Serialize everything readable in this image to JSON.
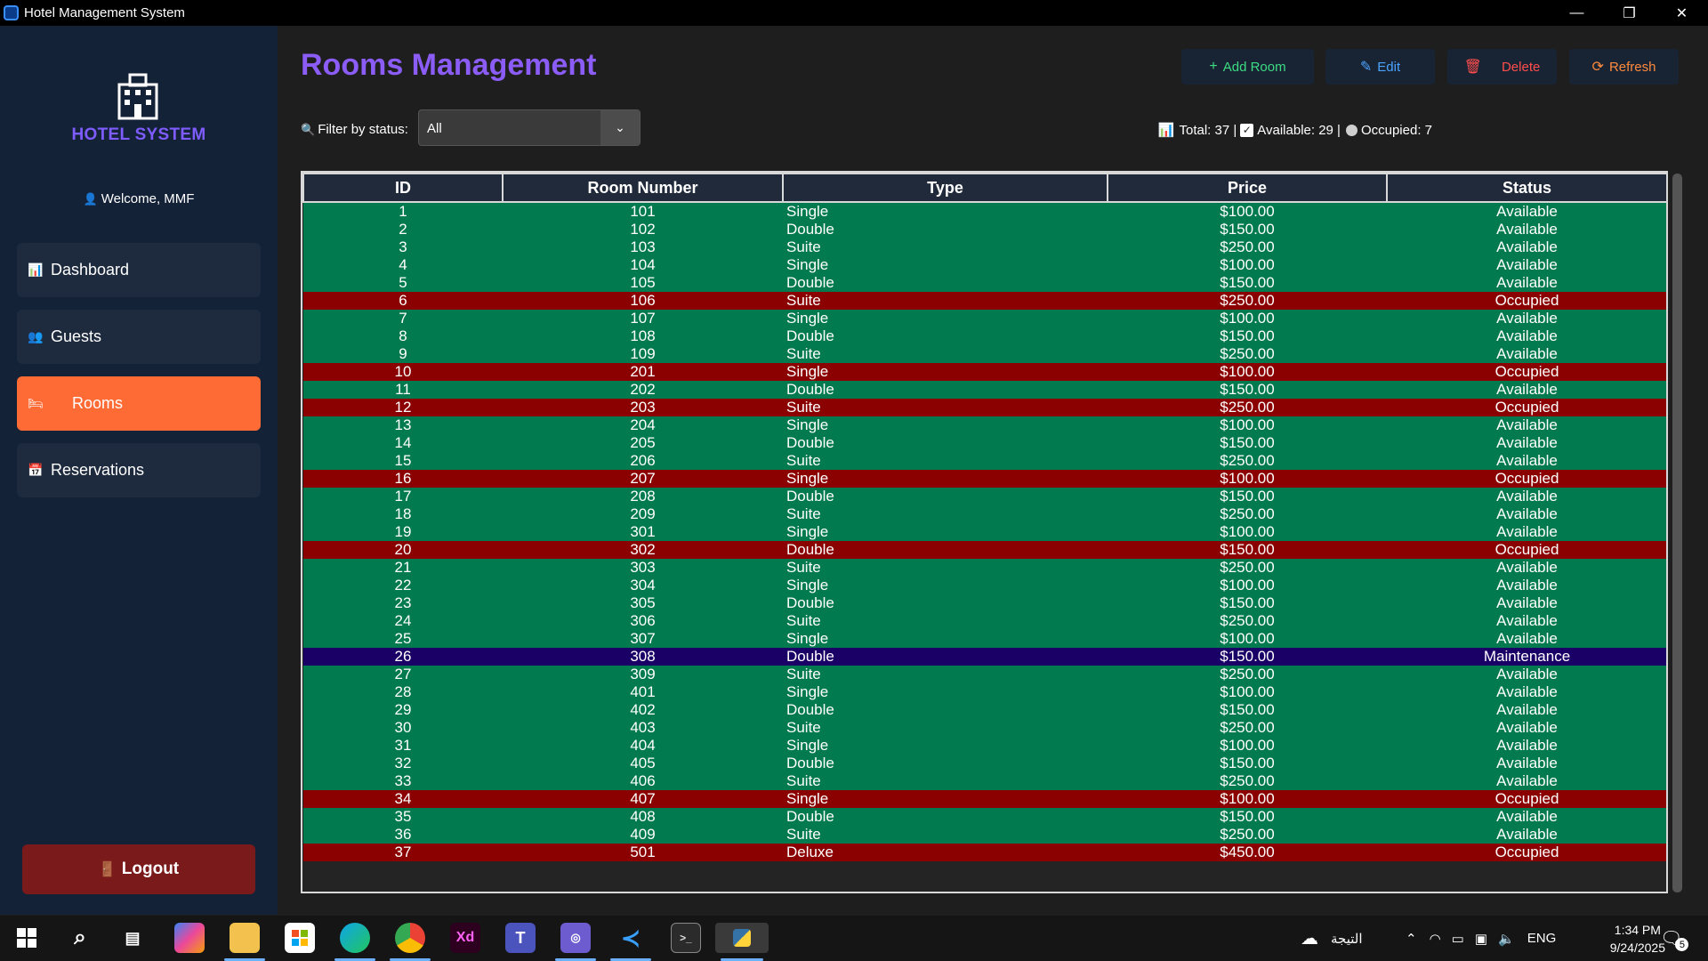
{
  "window": {
    "title": "Hotel Management System",
    "controls": [
      "—",
      "❐",
      "✕"
    ]
  },
  "sidebar": {
    "brand": "HOTEL SYSTEM",
    "welcome": "Welcome, MMF",
    "items": [
      {
        "label": "Dashboard",
        "icon": "bar-chart-icon"
      },
      {
        "label": "Guests",
        "icon": "guests-icon"
      },
      {
        "label": "Rooms",
        "icon": "bed-icon",
        "active": true
      },
      {
        "label": "Reservations",
        "icon": "calendar-icon"
      }
    ],
    "logout": "Logout"
  },
  "main": {
    "title": "Rooms Management",
    "toolbar": {
      "add": "Add Room",
      "edit": "Edit",
      "delete": "Delete",
      "refresh": "Refresh"
    },
    "filter": {
      "label": "Filter by status:",
      "value": "All"
    },
    "stats": {
      "total": "Total: 37 |",
      "available": "Available: 29 |",
      "occupied": "Occupied: 7"
    },
    "table": {
      "columns": [
        "ID",
        "Room Number",
        "Type",
        "Price",
        "Status"
      ],
      "rows": [
        [
          "1",
          "101",
          "Single",
          "$100.00",
          "Available"
        ],
        [
          "2",
          "102",
          "Double",
          "$150.00",
          "Available"
        ],
        [
          "3",
          "103",
          "Suite",
          "$250.00",
          "Available"
        ],
        [
          "4",
          "104",
          "Single",
          "$100.00",
          "Available"
        ],
        [
          "5",
          "105",
          "Double",
          "$150.00",
          "Available"
        ],
        [
          "6",
          "106",
          "Suite",
          "$250.00",
          "Occupied"
        ],
        [
          "7",
          "107",
          "Single",
          "$100.00",
          "Available"
        ],
        [
          "8",
          "108",
          "Double",
          "$150.00",
          "Available"
        ],
        [
          "9",
          "109",
          "Suite",
          "$250.00",
          "Available"
        ],
        [
          "10",
          "201",
          "Single",
          "$100.00",
          "Occupied"
        ],
        [
          "11",
          "202",
          "Double",
          "$150.00",
          "Available"
        ],
        [
          "12",
          "203",
          "Suite",
          "$250.00",
          "Occupied"
        ],
        [
          "13",
          "204",
          "Single",
          "$100.00",
          "Available"
        ],
        [
          "14",
          "205",
          "Double",
          "$150.00",
          "Available"
        ],
        [
          "15",
          "206",
          "Suite",
          "$250.00",
          "Available"
        ],
        [
          "16",
          "207",
          "Single",
          "$100.00",
          "Occupied"
        ],
        [
          "17",
          "208",
          "Double",
          "$150.00",
          "Available"
        ],
        [
          "18",
          "209",
          "Suite",
          "$250.00",
          "Available"
        ],
        [
          "19",
          "301",
          "Single",
          "$100.00",
          "Available"
        ],
        [
          "20",
          "302",
          "Double",
          "$150.00",
          "Occupied"
        ],
        [
          "21",
          "303",
          "Suite",
          "$250.00",
          "Available"
        ],
        [
          "22",
          "304",
          "Single",
          "$100.00",
          "Available"
        ],
        [
          "23",
          "305",
          "Double",
          "$150.00",
          "Available"
        ],
        [
          "24",
          "306",
          "Suite",
          "$250.00",
          "Available"
        ],
        [
          "25",
          "307",
          "Single",
          "$100.00",
          "Available"
        ],
        [
          "26",
          "308",
          "Double",
          "$150.00",
          "Maintenance"
        ],
        [
          "27",
          "309",
          "Suite",
          "$250.00",
          "Available"
        ],
        [
          "28",
          "401",
          "Single",
          "$100.00",
          "Available"
        ],
        [
          "29",
          "402",
          "Double",
          "$150.00",
          "Available"
        ],
        [
          "30",
          "403",
          "Suite",
          "$250.00",
          "Available"
        ],
        [
          "31",
          "404",
          "Single",
          "$100.00",
          "Available"
        ],
        [
          "32",
          "405",
          "Double",
          "$150.00",
          "Available"
        ],
        [
          "33",
          "406",
          "Suite",
          "$250.00",
          "Available"
        ],
        [
          "34",
          "407",
          "Single",
          "$100.00",
          "Occupied"
        ],
        [
          "35",
          "408",
          "Double",
          "$150.00",
          "Available"
        ],
        [
          "36",
          "409",
          "Suite",
          "$250.00",
          "Available"
        ],
        [
          "37",
          "501",
          "Deluxe",
          "$450.00",
          "Occupied"
        ]
      ]
    }
  },
  "taskbar": {
    "apps": [
      "windows-start-icon",
      "search-icon",
      "task-view-icon",
      "copilot-icon",
      "file-explorer-icon",
      "store-icon",
      "edge-icon",
      "chrome-icon",
      "adobe-xd-icon",
      "teams-icon",
      "app-icon",
      "vscode-icon",
      "terminal-icon",
      "python-icon"
    ],
    "tray_text": "التيجة",
    "lang": "ENG",
    "time": "1:34 PM",
    "date": "9/24/2025",
    "notifications": "5"
  },
  "colors": {
    "accent": "#8b5cf6",
    "active_nav": "#ff6b35",
    "available_row": "#017a4f",
    "occupied_row": "#8b0000",
    "maintenance_row": "#1a0066",
    "add_btn_text": "#3ddc84",
    "edit_btn_text": "#4aa3ff",
    "delete_btn_text": "#ff4d4d",
    "refresh_btn_text": "#ff8a3d"
  }
}
